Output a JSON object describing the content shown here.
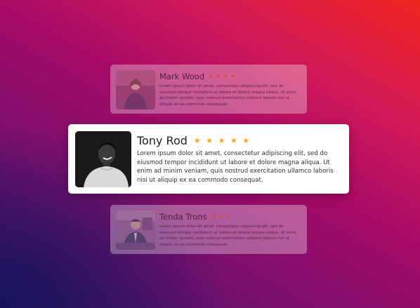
{
  "colors": {
    "star_main": "#f5a623",
    "star_faded": "#d54a2a",
    "card_main_bg": "#ffffff"
  },
  "testimonials": [
    {
      "name": "Mark Wood",
      "rating": 3.5,
      "stars": "★ ★ ★ ★",
      "text": "Lorem ipsum dolor sit amet, consectetur adipiscing elit, sed do eiusmod tempor incididunt ut labore et dolore magna aliqua. Ut enim ad minim veniam, quis nostrud exercitation ullamco laboris nisi ut aliquip ex ea commodo consequat.",
      "photo_icon": "person-photo-icon"
    },
    {
      "name": "Tony Rod",
      "rating": 4.5,
      "stars": "★ ★ ★ ★ ★",
      "text": "Lorem ipsum dolor sit amet, consectetur adipiscing elit, sed do eiusmod tempor incididunt ut labore et dolore magna aliqua. Ut enim ad minim veniam, quis nostrud exercitation ullamco laboris nisi ut aliquip ex ea commodo consequat.",
      "photo_icon": "person-photo-icon"
    },
    {
      "name": "Tenda Trons",
      "rating": 3,
      "stars": "★ ★ ★",
      "text": "Lorem ipsum dolor sit amet, consectetur adipiscing elit, sed do eiusmod tempor incididunt ut labore et dolore magna aliqua. Ut enim ad minim veniam, quis nostrud exercitation ullamco laboris nisi ut aliquip ex ea commodo consequat.",
      "photo_icon": "person-photo-icon"
    }
  ]
}
